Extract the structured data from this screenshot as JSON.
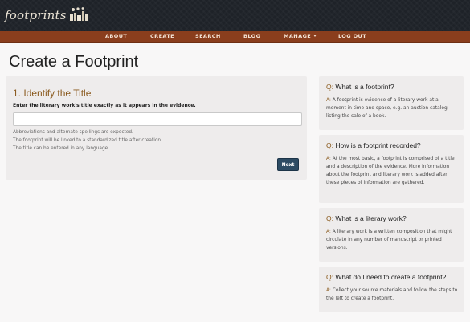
{
  "header": {
    "logo_text": "footprints"
  },
  "nav": {
    "items": [
      {
        "label": "ABOUT"
      },
      {
        "label": "CREATE"
      },
      {
        "label": "SEARCH"
      },
      {
        "label": "BLOG"
      },
      {
        "label": "MANAGE"
      },
      {
        "label": "LOG OUT"
      }
    ]
  },
  "page": {
    "title": "Create a Footprint"
  },
  "form": {
    "step_title": "1. Identify the Title",
    "field_label": "Enter the literary work's title exactly as it appears in the evidence.",
    "input_value": "",
    "help_lines": [
      "Abbreviations and alternate spellings are expected.",
      "The footprint will be linked to a standardized title after creation.",
      "The title can be entered in any language."
    ],
    "next_label": "Next"
  },
  "faq": {
    "q_mark": "Q:",
    "a_mark": "A:",
    "items": [
      {
        "question": "What is a footprint?",
        "answer": "A footprint is evidence of a literary work at a moment in time and space, e.g. an auction catalog listing the sale of a book."
      },
      {
        "question": "How is a footprint recorded?",
        "answer": "At the most basic, a footprint is comprised of a title and a description of the evidence. More information about the footprint and literary work is added after these pieces of information are gathered."
      },
      {
        "question": "What is a literary work?",
        "answer": "A literary work is a written composition that might circulate in any number of manuscript or printed versions."
      },
      {
        "question": "What do I need to create a footprint?",
        "answer": "Collect your source materials and follow the steps to the left to create a footprint."
      }
    ]
  },
  "colors": {
    "topbar": "#1e2228",
    "nav": "#8a3e1d",
    "accent": "#8a5a1e",
    "button": "#2c4b63"
  }
}
